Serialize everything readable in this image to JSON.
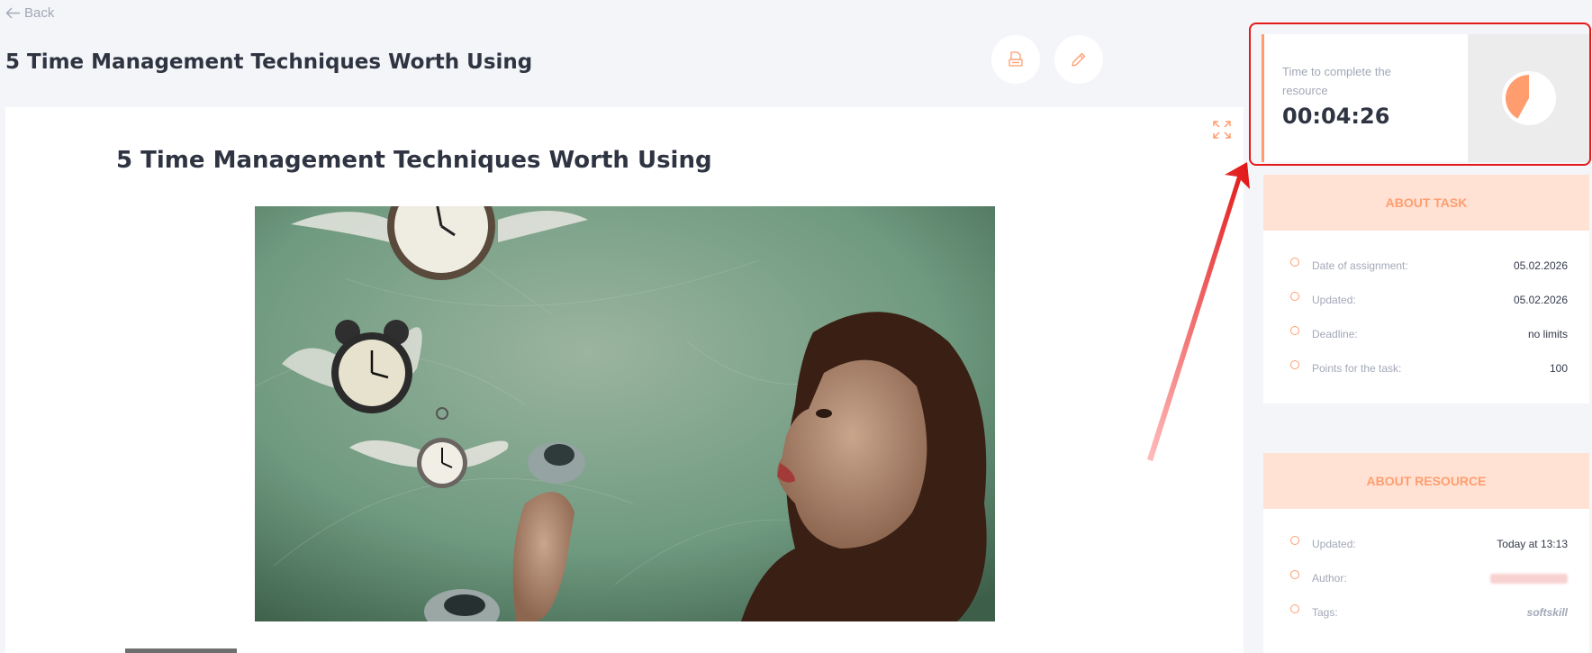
{
  "nav": {
    "back_label": "Back"
  },
  "header": {
    "title": "5 Time Management Techniques Worth Using"
  },
  "toolbar": {
    "print_icon": "printer-icon",
    "edit_icon": "pencil-icon"
  },
  "article": {
    "title": "5 Time Management Techniques Worth Using",
    "expand_icon": "expand-icon"
  },
  "timer": {
    "label": "Time to complete the resource",
    "value": "00:04:26",
    "progress_fraction": 0.42,
    "progress_color": "#ff9d6f"
  },
  "about_task": {
    "title": "ABOUT TASK",
    "rows": [
      {
        "label": "Date of assignment:",
        "value": "05.02.2026"
      },
      {
        "label": "Updated:",
        "value": "05.02.2026"
      },
      {
        "label": "Deadline:",
        "value": "no limits"
      },
      {
        "label": "Points for the task:",
        "value": "100"
      }
    ]
  },
  "about_resource": {
    "title": "ABOUT RESOURCE",
    "rows": [
      {
        "label": "Updated:",
        "value": "Today at 13:13"
      },
      {
        "label": "Author:",
        "value": ""
      },
      {
        "label": "Tags:",
        "value": "softskill"
      }
    ]
  },
  "colors": {
    "accent": "#ff9d6f",
    "accent_light": "#ffe2d4",
    "highlight": "#e41a1a"
  }
}
